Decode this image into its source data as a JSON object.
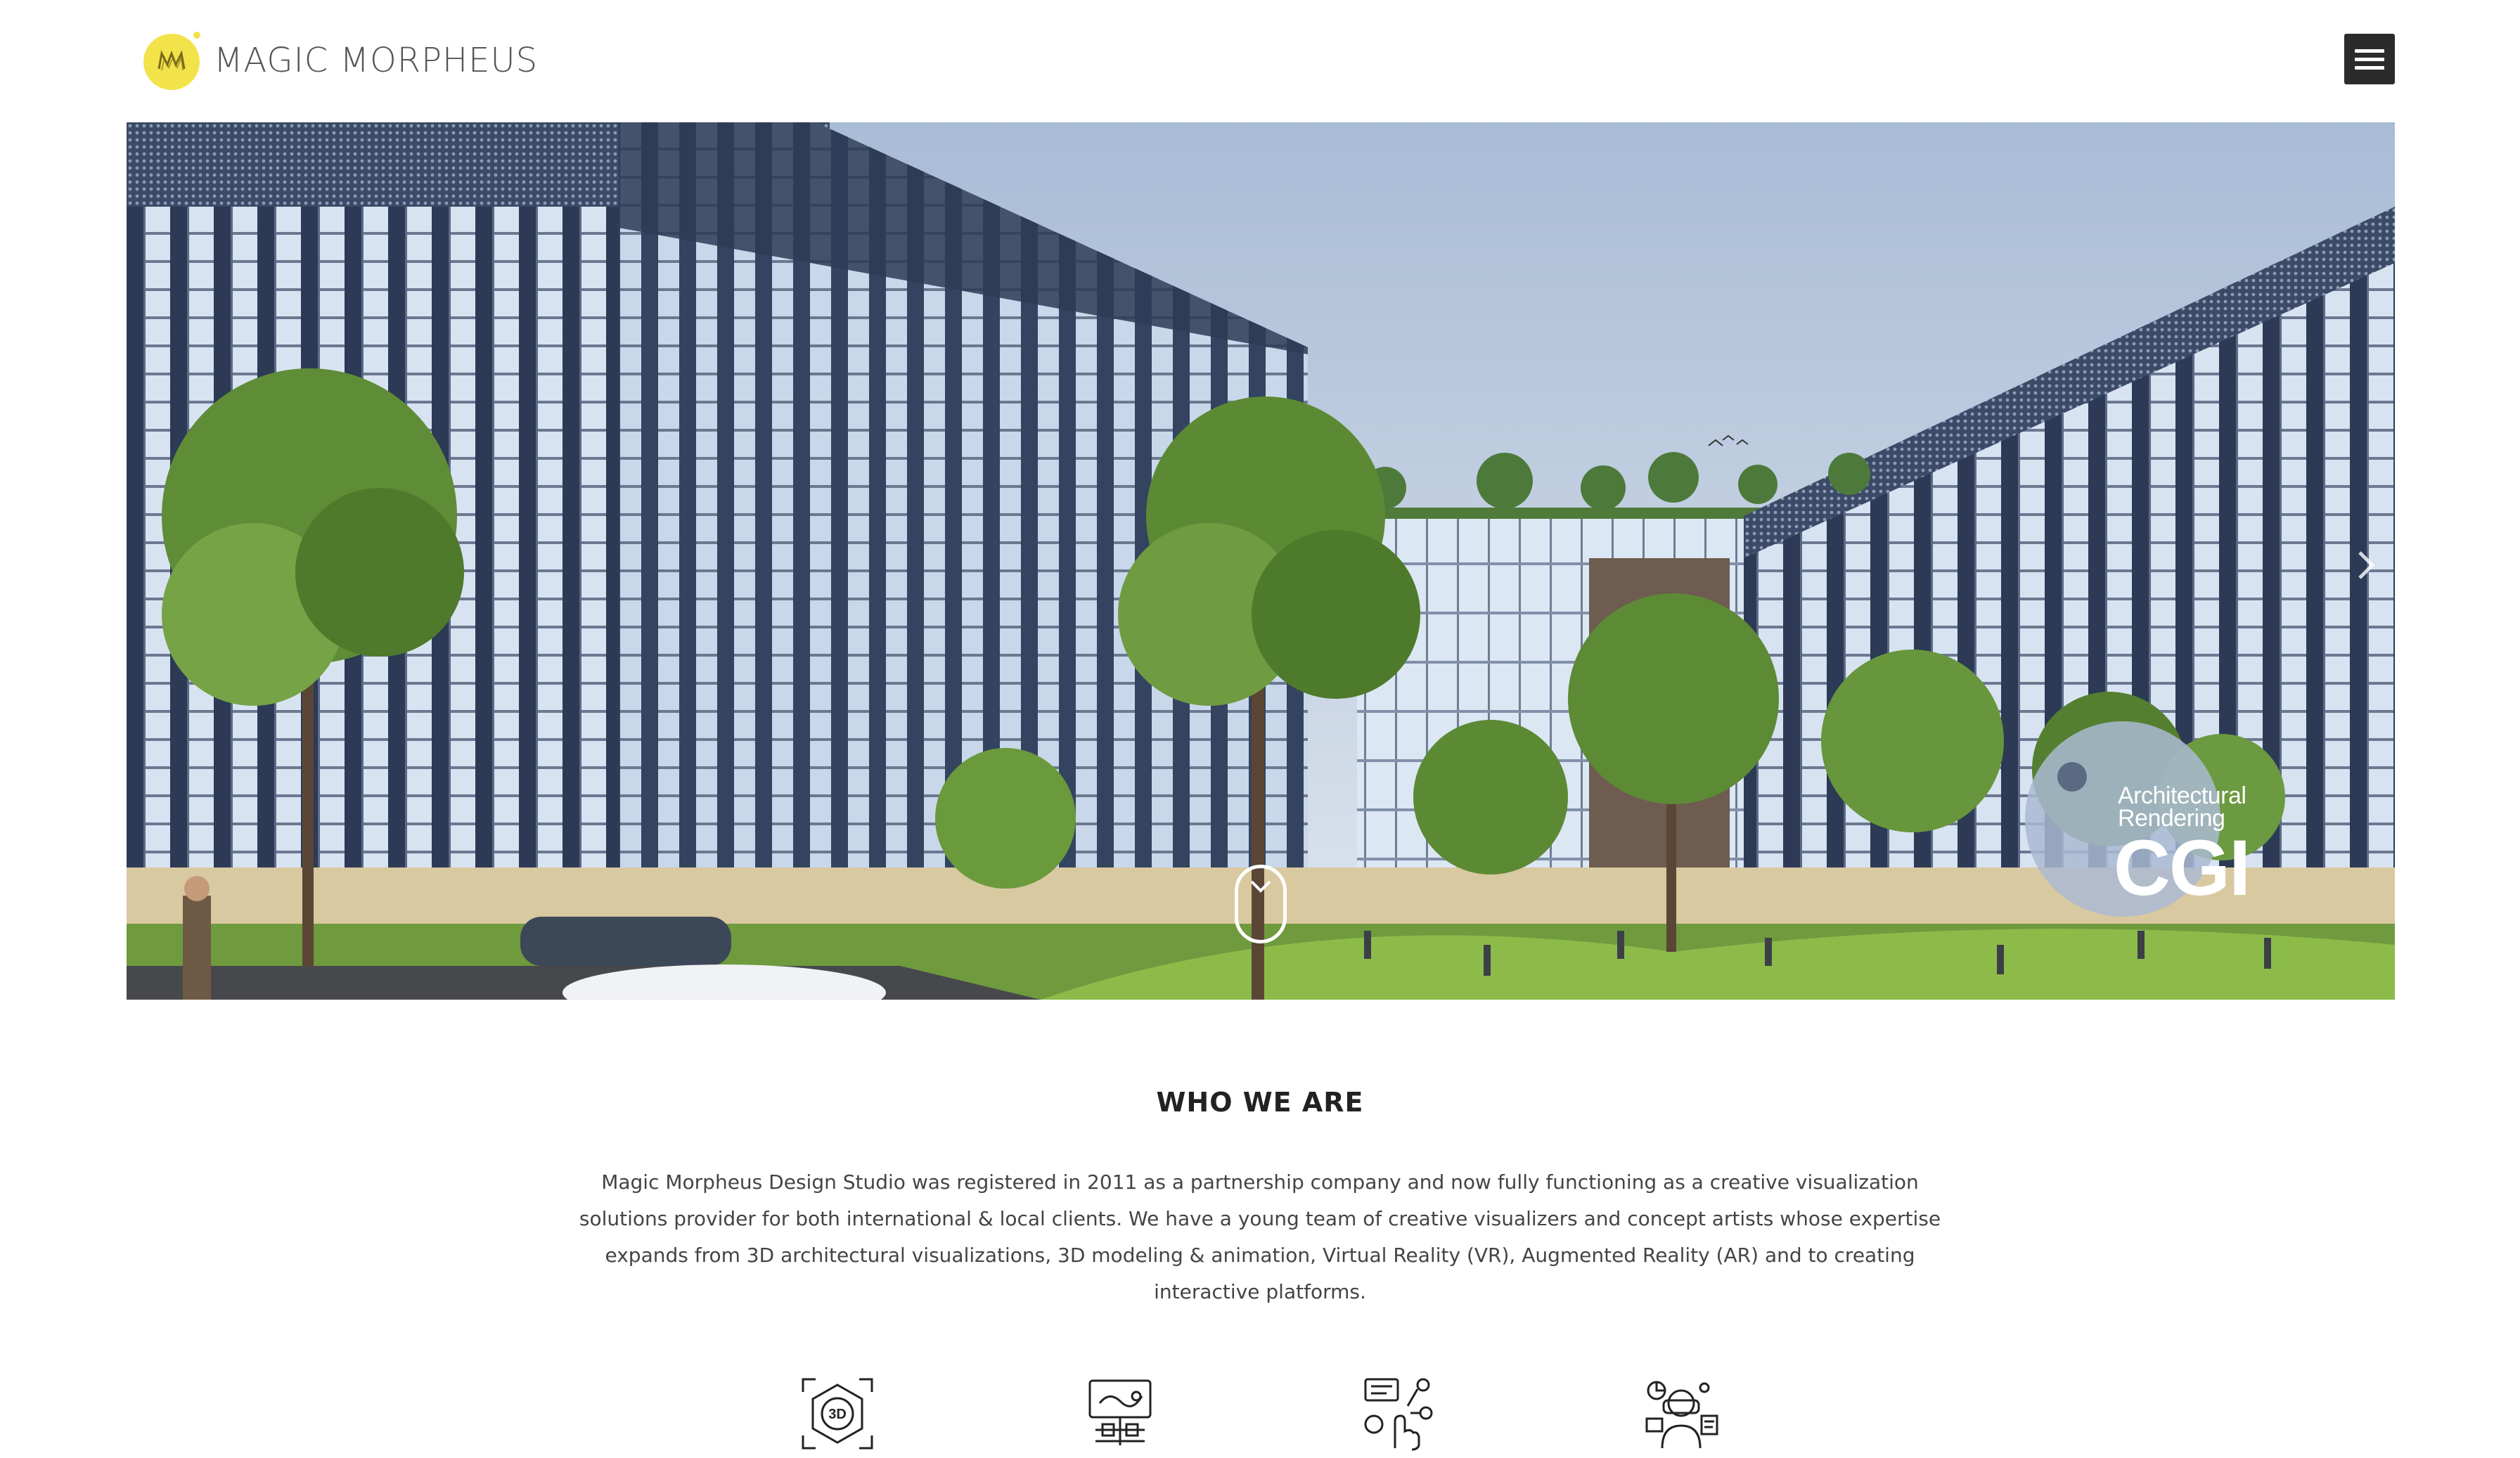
{
  "header": {
    "brand_name": "MAGIC MORPHEUS",
    "logo_icon": "magic-morpheus-logo-icon",
    "menu_icon": "hamburger-menu-icon",
    "brand_color": "#f3e34a"
  },
  "hero": {
    "badge_line1": "Architectural",
    "badge_line2": "Rendering",
    "badge_big": "CGI",
    "next_icon": "chevron-right-icon",
    "scroll_icon": "scroll-down-icon"
  },
  "about": {
    "title": "WHO WE ARE",
    "body": "Magic Morpheus Design Studio was registered in 2011 as a partnership company and now fully functioning as a creative visualization solutions provider for both international & local clients. We have a young team of creative visualizers and concept artists whose expertise expands from 3D architectural visualizations, 3D modeling & animation, Virtual Reality (VR), Augmented Reality (AR) and to creating interactive platforms."
  },
  "services": [
    {
      "icon": "3d-visualization-icon"
    },
    {
      "icon": "architectural-plan-icon"
    },
    {
      "icon": "interactive-touch-icon"
    },
    {
      "icon": "virtual-reality-icon"
    }
  ]
}
